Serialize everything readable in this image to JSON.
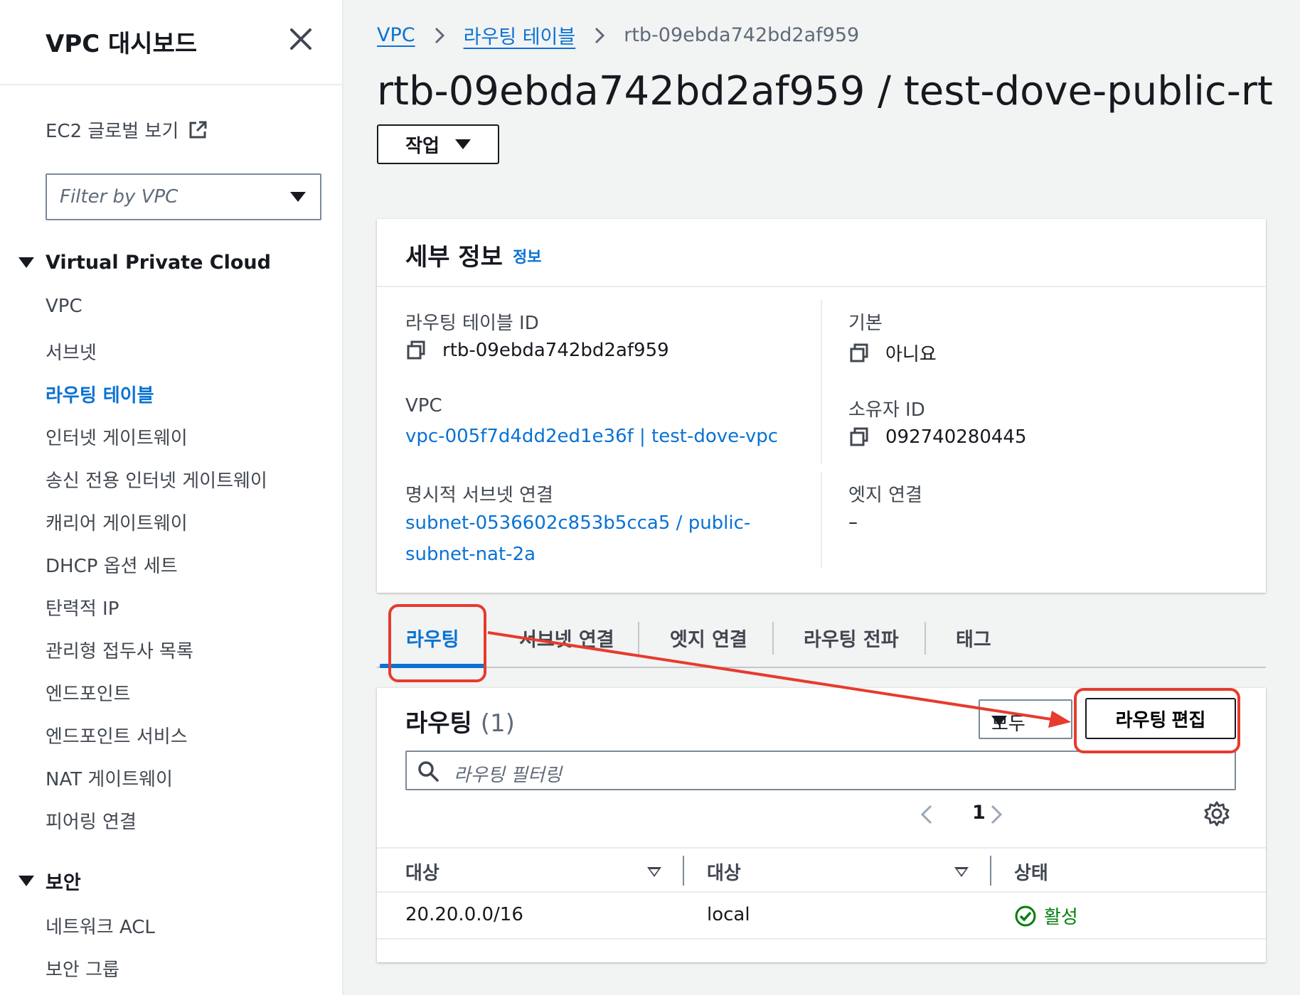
{
  "sidebar": {
    "title": "VPC 대시보드",
    "ec2_global": "EC2 글로벌 보기",
    "filter_placeholder": "Filter by VPC",
    "sections": [
      {
        "label": "Virtual Private Cloud"
      },
      {
        "label": "보안"
      }
    ],
    "items": [
      {
        "label": "VPC"
      },
      {
        "label": "서브넷"
      },
      {
        "label": "라우팅 테이블",
        "active": true
      },
      {
        "label": "인터넷 게이트웨이"
      },
      {
        "label": "송신 전용 인터넷 게이트웨이"
      },
      {
        "label": "캐리어 게이트웨이"
      },
      {
        "label": "DHCP 옵션 세트"
      },
      {
        "label": "탄력적 IP"
      },
      {
        "label": "관리형 접두사 목록"
      },
      {
        "label": "엔드포인트"
      },
      {
        "label": "엔드포인트 서비스"
      },
      {
        "label": "NAT 게이트웨이"
      },
      {
        "label": "피어링 연결"
      }
    ],
    "security_items": [
      {
        "label": "네트워크 ACL"
      },
      {
        "label": "보안 그룹"
      }
    ]
  },
  "breadcrumb": {
    "items": [
      "VPC",
      "라우팅 테이블"
    ],
    "current": "rtb-09ebda742bd2af959"
  },
  "page": {
    "title": "rtb-09ebda742bd2af959 / test-dove-public-rt",
    "actions_label": "작업"
  },
  "details": {
    "title": "세부 정보",
    "info": "정보",
    "rt_id_label": "라우팅 테이블 ID",
    "rt_id_value": "rtb-09ebda742bd2af959",
    "main_label": "기본",
    "main_value": "아니요",
    "vpc_label": "VPC",
    "vpc_value": "vpc-005f7d4dd2ed1e36f | test-dove-vpc",
    "owner_label": "소유자 ID",
    "owner_value": "092740280445",
    "explicit_label": "명시적 서브넷 연결",
    "explicit_value_line1": "subnet-0536602c853b5cca5 / public-",
    "explicit_value_line2": "subnet-nat-2a",
    "edge_label": "엣지 연결",
    "edge_value": "–"
  },
  "tabs": [
    "라우팅",
    "서브넷 연결",
    "엣지 연결",
    "라우팅 전파",
    "태그"
  ],
  "routes": {
    "title": "라우팅",
    "count": "(1)",
    "select_value": "모두",
    "edit_label": "라우팅 편집",
    "search_placeholder": "라우팅 필터링",
    "page": "1",
    "columns": [
      "대상",
      "대상",
      "상태"
    ],
    "rows": [
      {
        "destination": "20.20.0.0/16",
        "target": "local",
        "status": "활성"
      }
    ]
  },
  "colors": {
    "link": "#0972d3",
    "status_ok": "#037f0c",
    "annotation": "#e63b2e"
  }
}
